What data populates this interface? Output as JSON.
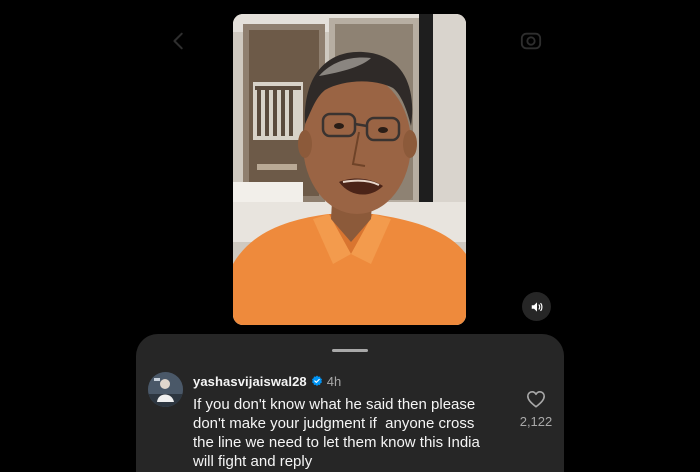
{
  "icons": {
    "back": "chevron-left-icon",
    "reels": "camera-icon",
    "mute": "speaker-icon",
    "verified": "verified-badge-icon",
    "like": "heart-icon"
  },
  "colors": {
    "sheet_background": "#262626",
    "primary_text": "#f5f5f5",
    "secondary_text": "#a8a8a8",
    "verified_blue": "#0095f6"
  },
  "comment": {
    "username": "yashasvijaiswal28",
    "time": "4h",
    "text": "If you don't know what he said then please don't make your judgment if  anyone cross the line we need to let them know this India will fight and reply",
    "like_count": "2,122"
  }
}
